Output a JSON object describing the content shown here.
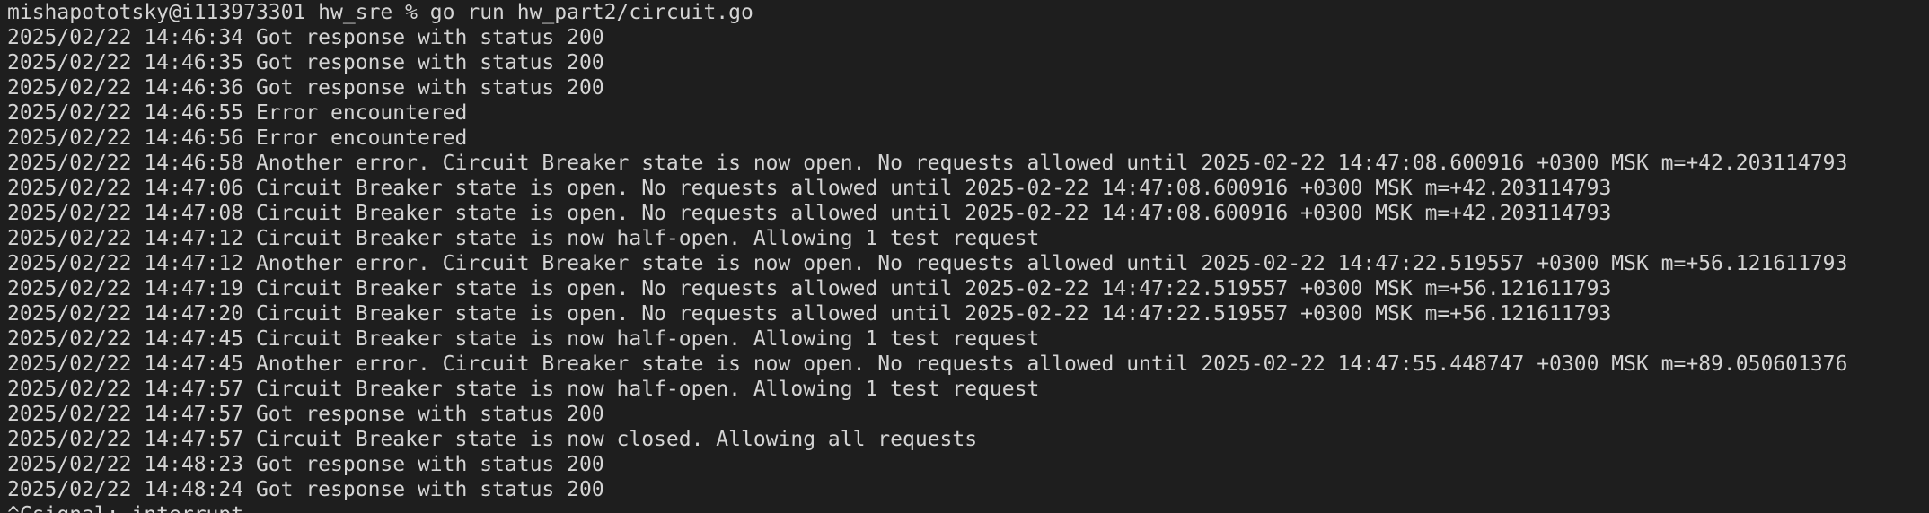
{
  "terminal": {
    "prompt": "mishapototsky@i113973301 hw_sre % go run hw_part2/circuit.go",
    "lines": [
      "2025/02/22 14:46:34 Got response with status 200",
      "2025/02/22 14:46:35 Got response with status 200",
      "2025/02/22 14:46:36 Got response with status 200",
      "2025/02/22 14:46:55 Error encountered",
      "2025/02/22 14:46:56 Error encountered",
      "2025/02/22 14:46:58 Another error. Circuit Breaker state is now open. No requests allowed until 2025-02-22 14:47:08.600916 +0300 MSK m=+42.203114793",
      "2025/02/22 14:47:06 Circuit Breaker state is open. No requests allowed until 2025-02-22 14:47:08.600916 +0300 MSK m=+42.203114793",
      "2025/02/22 14:47:08 Circuit Breaker state is open. No requests allowed until 2025-02-22 14:47:08.600916 +0300 MSK m=+42.203114793",
      "2025/02/22 14:47:12 Circuit Breaker state is now half-open. Allowing 1 test request",
      "2025/02/22 14:47:12 Another error. Circuit Breaker state is now open. No requests allowed until 2025-02-22 14:47:22.519557 +0300 MSK m=+56.121611793",
      "2025/02/22 14:47:19 Circuit Breaker state is open. No requests allowed until 2025-02-22 14:47:22.519557 +0300 MSK m=+56.121611793",
      "2025/02/22 14:47:20 Circuit Breaker state is open. No requests allowed until 2025-02-22 14:47:22.519557 +0300 MSK m=+56.121611793",
      "2025/02/22 14:47:45 Circuit Breaker state is now half-open. Allowing 1 test request",
      "2025/02/22 14:47:45 Another error. Circuit Breaker state is now open. No requests allowed until 2025-02-22 14:47:55.448747 +0300 MSK m=+89.050601376",
      "2025/02/22 14:47:57 Circuit Breaker state is now half-open. Allowing 1 test request",
      "2025/02/22 14:47:57 Got response with status 200",
      "2025/02/22 14:47:57 Circuit Breaker state is now closed. Allowing all requests",
      "2025/02/22 14:48:23 Got response with status 200",
      "2025/02/22 14:48:24 Got response with status 200"
    ],
    "tail": "^Csignal: interrupt"
  },
  "colors": {
    "background": "#1e1e1e",
    "text": "#d4d4d4"
  }
}
